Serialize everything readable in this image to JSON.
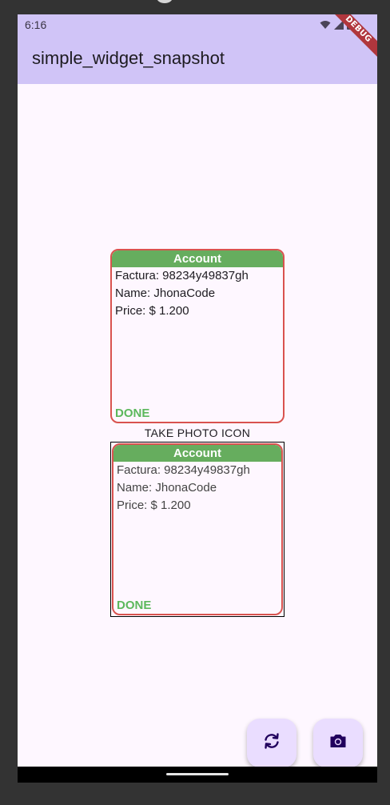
{
  "status_bar": {
    "time": "6:16",
    "icons": [
      "wifi-icon",
      "signal-icon",
      "battery-icon"
    ]
  },
  "app_bar": {
    "title": "simple_widget_snapshot",
    "debug_banner": "DEBUG"
  },
  "card": {
    "header": "Account",
    "factura": "Factura: 98234y49837gh",
    "name": "Name: JhonaCode",
    "price": "Price: $ 1.200",
    "status": "DONE"
  },
  "snapshot": {
    "label": "TAKE PHOTO ICON",
    "card": {
      "header": "Account",
      "factura": "Factura: 98234y49837gh",
      "name": "Name: JhonaCode",
      "price": "Price: $ 1.200",
      "status": "DONE"
    }
  },
  "fabs": [
    {
      "icon": "refresh-icon"
    },
    {
      "icon": "camera-icon"
    }
  ],
  "colors": {
    "app_bar": "#d0c4f7",
    "background": "#fef7ff",
    "card_header": "#66ad5e",
    "card_border": "#d9534f",
    "done_text": "#5cb85c",
    "fab": "#eaddff",
    "icon": "#21005d"
  }
}
